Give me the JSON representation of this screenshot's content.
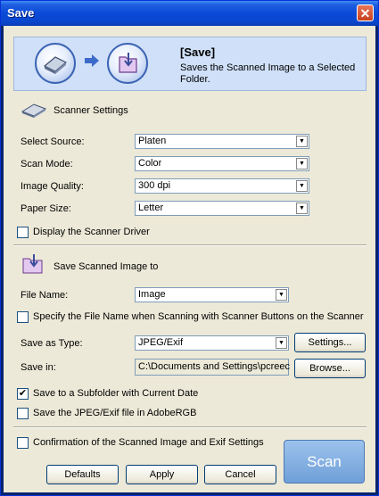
{
  "window": {
    "title": "Save",
    "close_glyph": "✕"
  },
  "banner": {
    "title": "[Save]",
    "description": "Saves the Scanned Image to a Selected Folder.",
    "icons": [
      "scanner-icon",
      "arrow-right-icon",
      "save-folder-icon"
    ]
  },
  "scanner_settings": {
    "heading": "Scanner Settings",
    "select_source": {
      "label": "Select Source:",
      "value": "Platen"
    },
    "scan_mode": {
      "label": "Scan Mode:",
      "value": "Color"
    },
    "image_quality": {
      "label": "Image Quality:",
      "value": "300 dpi"
    },
    "paper_size": {
      "label": "Paper Size:",
      "value": "Letter"
    },
    "display_driver": {
      "label": "Display the Scanner Driver",
      "checked": false
    }
  },
  "save_settings": {
    "heading": "Save Scanned Image to",
    "file_name": {
      "label": "File Name:",
      "value": "Image"
    },
    "specify_name": {
      "label": "Specify the File Name when Scanning with Scanner Buttons on the Scanner",
      "checked": false
    },
    "save_as_type": {
      "label": "Save as Type:",
      "value": "JPEG/Exif"
    },
    "settings_button": "Settings...",
    "save_in": {
      "label": "Save in:",
      "value": "C:\\Documents and Settings\\pcreecy"
    },
    "browse_button": "Browse...",
    "subfolder": {
      "label": "Save to a Subfolder with Current Date",
      "checked": true
    },
    "adobergb": {
      "label": "Save the JPEG/Exif file in AdobeRGB",
      "checked": false
    }
  },
  "confirmation": {
    "label": "Confirmation of the Scanned Image and Exif Settings",
    "checked": false
  },
  "buttons": {
    "defaults": "Defaults",
    "apply": "Apply",
    "cancel": "Cancel",
    "scan": "Scan"
  },
  "check_glyph": "✔",
  "dropdown_glyph": "▼"
}
